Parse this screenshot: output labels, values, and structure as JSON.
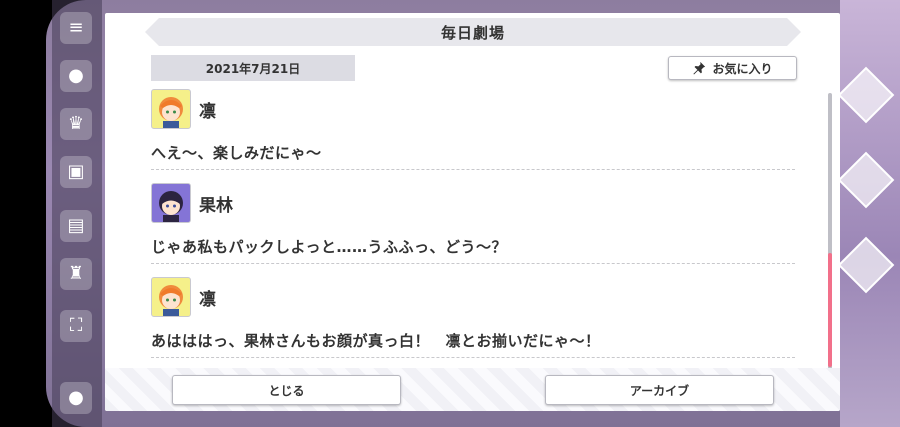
{
  "dialog": {
    "title": "毎日劇場",
    "date": "2021年7月21日",
    "favorite_label": "お気に入り",
    "messages": [
      {
        "speaker": "凛",
        "text": "へえ〜、楽しみだにゃ〜"
      },
      {
        "speaker": "果林",
        "text": "じゃあ私もパックしよっと……うふふっ、どう〜？"
      },
      {
        "speaker": "凛",
        "text": "あはははっ、果林さんもお顔が真っ白！　凛とお揃いだにゃ〜！"
      }
    ],
    "close_label": "とじる",
    "archive_label": "アーカイブ"
  },
  "colors": {
    "accent_scrollbar": "#f2708a",
    "rin_avatar_bg": "#f5f08a",
    "hanayo_avatar_bg": "#8474d6"
  },
  "icons": {
    "favorite": "pushpin-icon",
    "background_menu": "hamburger-menu-icon"
  }
}
